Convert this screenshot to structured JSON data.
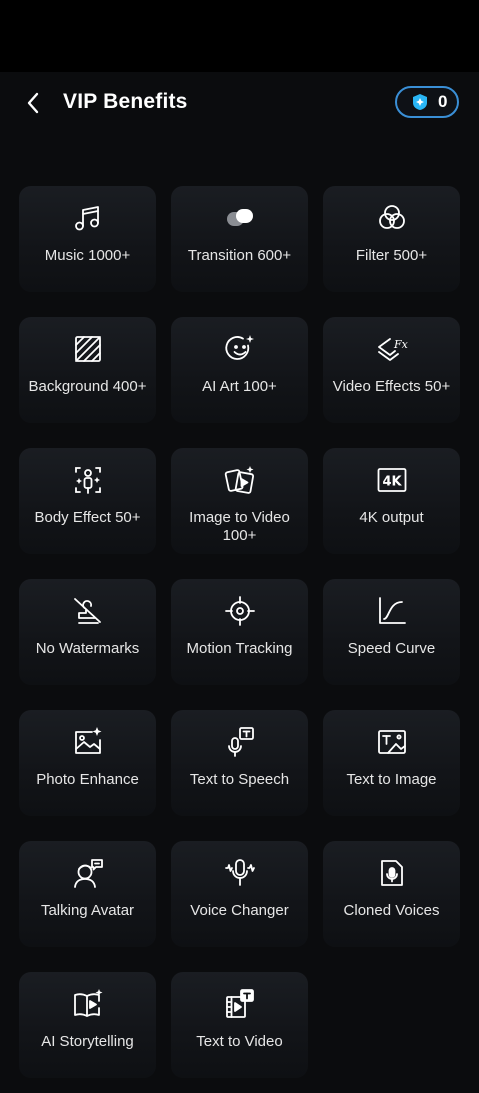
{
  "header": {
    "title": "VIP Benefits",
    "coin_count": "0"
  },
  "colors": {
    "background": "#0b0c0e",
    "card": "#16181c",
    "accent_border": "#3a8fd6",
    "coin_icon": "#29b6f6"
  },
  "benefits": [
    {
      "label": "Music 1000+",
      "icon": "music-note-icon"
    },
    {
      "label": "Transition 600+",
      "icon": "transition-icon"
    },
    {
      "label": "Filter 500+",
      "icon": "filter-circles-icon"
    },
    {
      "label": "Background 400+",
      "icon": "background-hatch-icon"
    },
    {
      "label": "AI Art 100+",
      "icon": "ai-art-smile-icon"
    },
    {
      "label": "Video Effects 50+",
      "icon": "video-effects-fx-icon"
    },
    {
      "label": "Body Effect 50+",
      "icon": "body-effect-icon"
    },
    {
      "label": "Image to Video 100+",
      "icon": "image-to-video-cards-icon"
    },
    {
      "label": "4K output",
      "icon": "4k-icon"
    },
    {
      "label": "No Watermarks",
      "icon": "no-watermark-icon"
    },
    {
      "label": "Motion Tracking",
      "icon": "motion-tracking-icon"
    },
    {
      "label": "Speed Curve",
      "icon": "speed-curve-icon"
    },
    {
      "label": "Photo Enhance",
      "icon": "photo-enhance-icon"
    },
    {
      "label": "Text to Speech",
      "icon": "text-to-speech-icon"
    },
    {
      "label": "Text to Image",
      "icon": "text-to-image-icon"
    },
    {
      "label": "Talking Avatar",
      "icon": "talking-avatar-icon"
    },
    {
      "label": "Voice Changer",
      "icon": "voice-changer-icon"
    },
    {
      "label": "Cloned Voices",
      "icon": "cloned-voices-icon"
    },
    {
      "label": "AI Storytelling",
      "icon": "ai-storytelling-icon"
    },
    {
      "label": "Text to Video",
      "icon": "text-to-video-icon"
    }
  ]
}
